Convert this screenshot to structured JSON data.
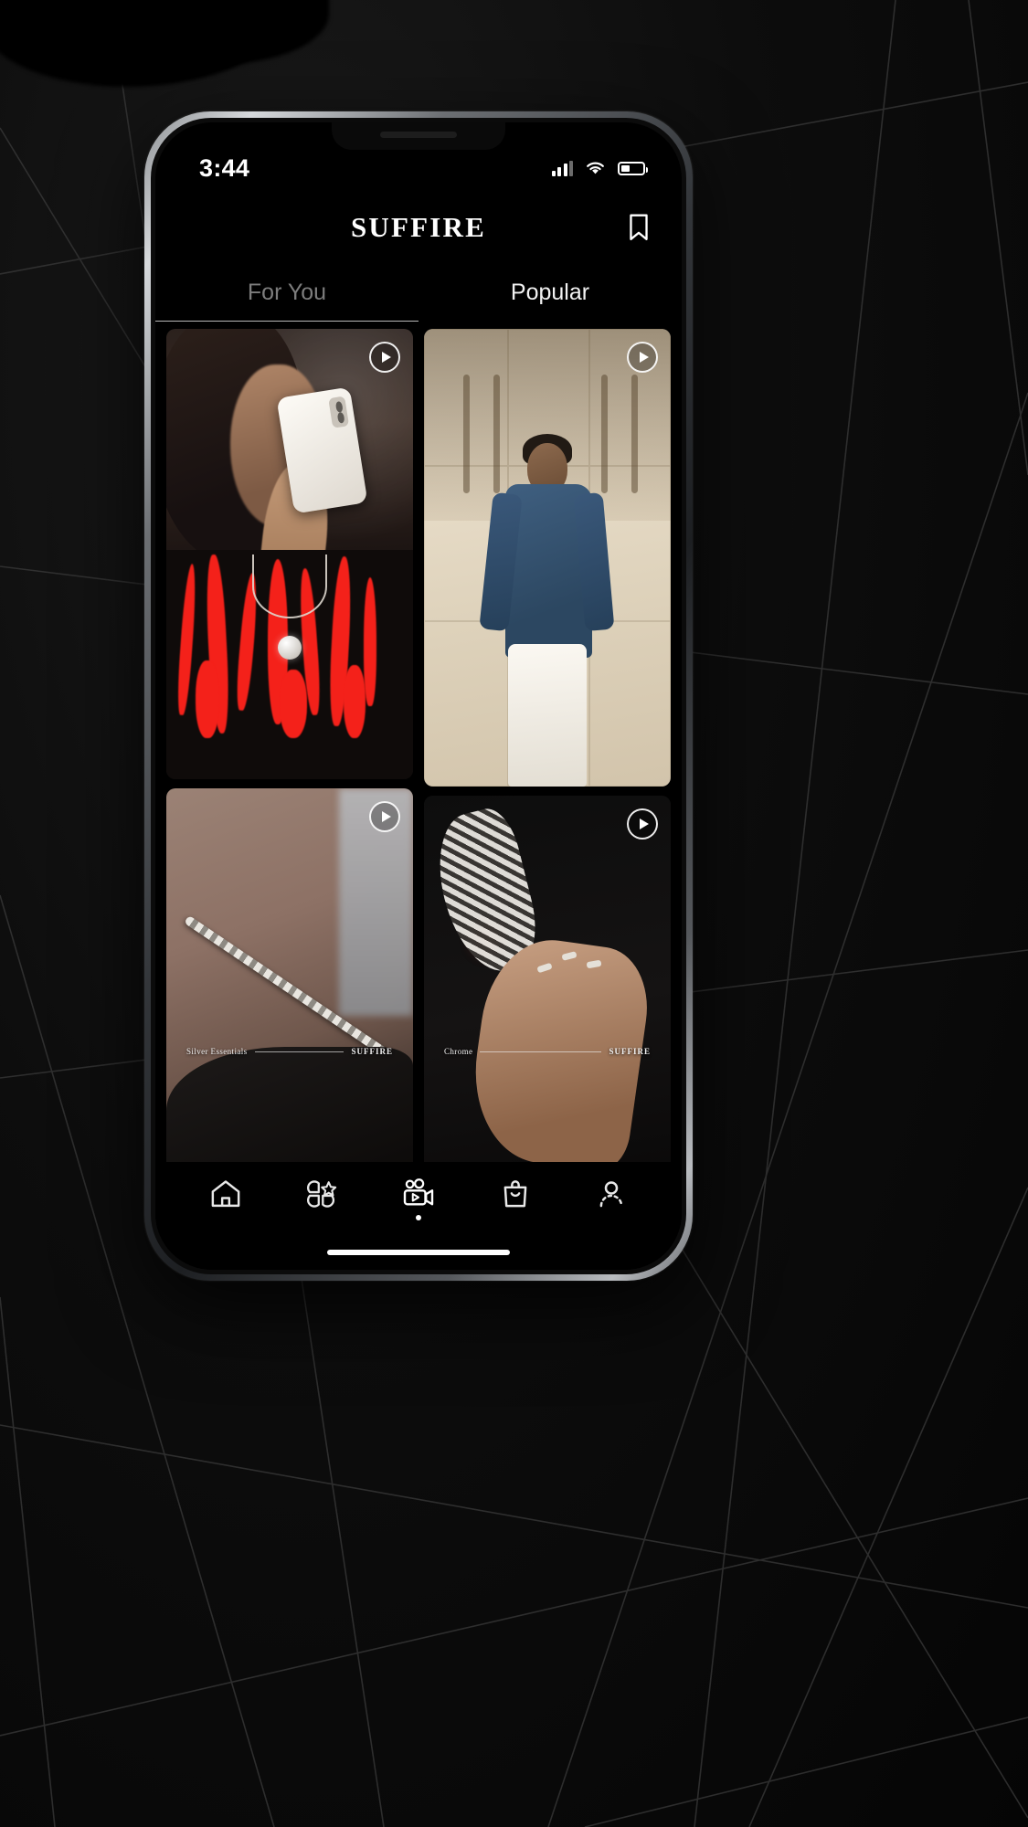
{
  "statusbar": {
    "time": "3:44",
    "signal_icon": "cellular-signal-icon",
    "wifi_icon": "wifi-icon",
    "battery_icon": "battery-icon",
    "battery_level_pct": 42
  },
  "header": {
    "brand": "SUFFIRE",
    "bookmark_icon": "bookmark-icon"
  },
  "tabs": [
    {
      "label": "For You",
      "active": false
    },
    {
      "label": "Popular",
      "active": true
    }
  ],
  "feed": {
    "play_icon": "play-circle-icon",
    "cards": [
      {
        "id": "card-1",
        "alt": "Woman taking mirror selfie wearing red flame print tee",
        "has_play": true,
        "caption": null
      },
      {
        "id": "card-2",
        "alt": "Man in blue denim shirt and white trousers leaning on wall",
        "has_play": true,
        "caption": null
      },
      {
        "id": "card-3",
        "alt": "Close up of neck wearing silver curb chain",
        "has_play": true,
        "caption": {
          "title": "Silver Essentials",
          "brand": "SUFFIRE"
        }
      },
      {
        "id": "card-4",
        "alt": "Hand with rings next to patterned sneaker",
        "has_play": true,
        "caption": {
          "title": "Chrome",
          "brand": "SUFFIRE"
        }
      }
    ]
  },
  "bottom_nav": {
    "items": [
      {
        "name": "home",
        "icon": "home-icon",
        "active": false
      },
      {
        "name": "discover",
        "icon": "grid-star-icon",
        "active": false
      },
      {
        "name": "reels",
        "icon": "video-camera-icon",
        "active": true
      },
      {
        "name": "shop",
        "icon": "shopping-bag-icon",
        "active": false
      },
      {
        "name": "profile",
        "icon": "user-icon",
        "active": false
      }
    ]
  },
  "colors": {
    "background": "#000000",
    "accent": "#ffffff",
    "muted_text": "#7d7d7d",
    "flame_red": "#f4211a",
    "denim_blue": "#3f5f80"
  }
}
